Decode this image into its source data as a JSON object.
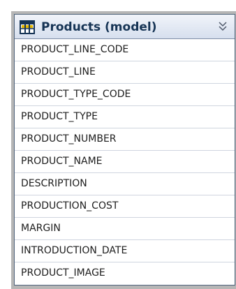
{
  "header": {
    "title": "Products (model)",
    "icon": "table-icon",
    "collapse_icon": "double-chevron-down-icon"
  },
  "fields": [
    "PRODUCT_LINE_CODE",
    "PRODUCT_LINE",
    "PRODUCT_TYPE_CODE",
    "PRODUCT_TYPE",
    "PRODUCT_NUMBER",
    "PRODUCT_NAME",
    "DESCRIPTION",
    "PRODUCTION_COST",
    "MARGIN",
    "INTRODUCTION_DATE",
    "PRODUCT_IMAGE"
  ],
  "colors": {
    "title_text": "#163455",
    "header_top": "#f1f4fa",
    "header_bottom": "#d6dfee",
    "border": "#50647c",
    "row_separator": "#cfd5df",
    "row_text": "#1d1d1d",
    "backdrop": "#b6b6b6"
  }
}
